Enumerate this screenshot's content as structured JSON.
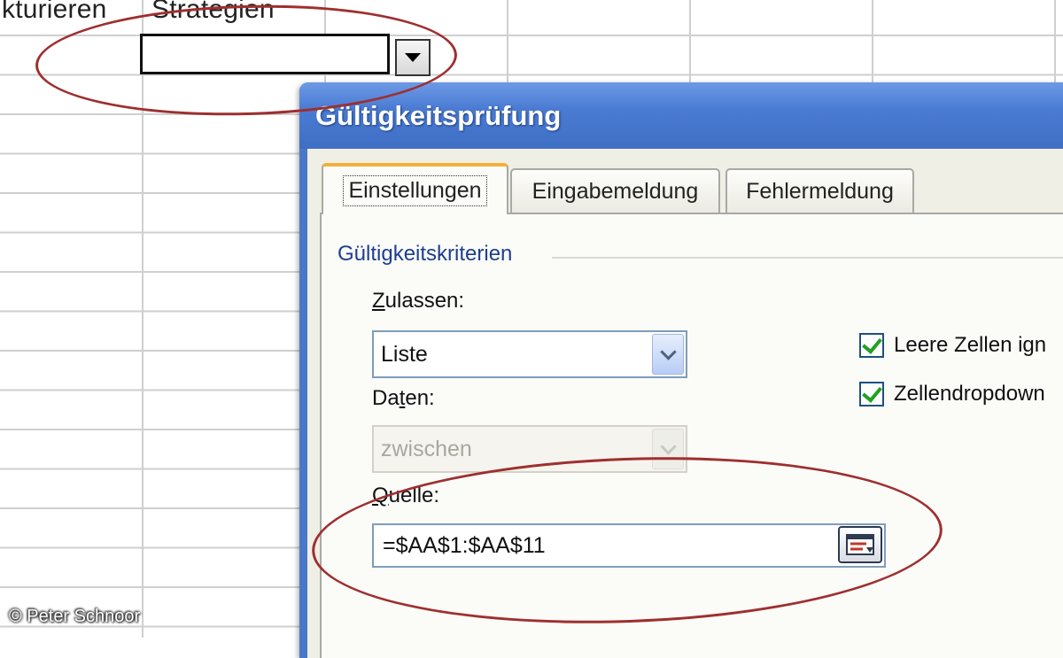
{
  "sheet": {
    "header_left": "kturieren",
    "header_strategies": "Strategien"
  },
  "copyright": "© Peter Schnoor",
  "dialog": {
    "title": "Gültigkeitsprüfung",
    "tabs": [
      {
        "label": "Einstellungen",
        "active": true
      },
      {
        "label": "Eingabemeldung",
        "active": false
      },
      {
        "label": "Fehlermeldung",
        "active": false
      }
    ],
    "group_label": "Gültigkeitskriterien",
    "allow": {
      "label_hotkey": "Z",
      "label_rest": "ulassen:",
      "value": "Liste"
    },
    "data": {
      "label_pre": "Da",
      "label_hotkey": "t",
      "label_rest": "en:",
      "value": "zwischen",
      "disabled": true
    },
    "source": {
      "label_hotkey": "Q",
      "label_rest": "uelle:",
      "value": "=$AA$1:$AA$11"
    },
    "checkboxes": [
      {
        "label": "Leere Zellen ign",
        "checked": true
      },
      {
        "label": "Zellendropdown",
        "checked": true
      }
    ]
  },
  "annotation_color": "#9e2f2f"
}
